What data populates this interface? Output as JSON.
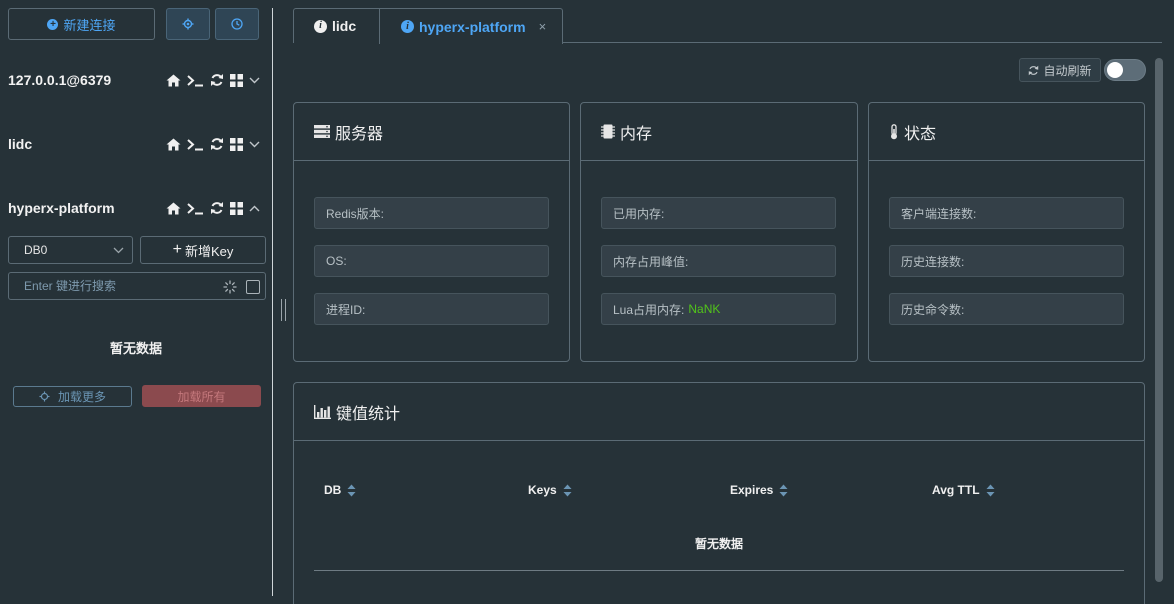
{
  "sidebar": {
    "new_connection_label": "新建连接",
    "settings_icon": "gear-icon",
    "history_icon": "clock-icon",
    "connections": [
      {
        "name": "127.0.0.1@6379",
        "expanded": false
      },
      {
        "name": "lidc",
        "expanded": false
      },
      {
        "name": "hyperx-platform",
        "expanded": true
      }
    ],
    "db_select_value": "DB0",
    "new_key_label": "新增Key",
    "search_placeholder": "Enter 键进行搜索",
    "empty_text": "暂无数据",
    "load_more_label": "加载更多",
    "load_all_label": "加载所有"
  },
  "tabs": [
    {
      "label": "lidc",
      "active": false
    },
    {
      "label": "hyperx-platform",
      "active": true,
      "close": "×"
    }
  ],
  "toolbar": {
    "auto_refresh_label": "自动刷新",
    "auto_refresh_enabled": false
  },
  "cards": {
    "server": {
      "title": "服务器",
      "fields": [
        "Redis版本:",
        "OS:",
        "进程ID:"
      ]
    },
    "memory": {
      "title": "内存",
      "fields": [
        "已用内存:",
        "内存占用峰值:",
        "Lua占用内存:"
      ],
      "lua_value": "NaNK"
    },
    "status": {
      "title": "状态",
      "fields": [
        "客户端连接数:",
        "历史连接数:",
        "历史命令数:"
      ]
    },
    "stats": {
      "title": "键值统计",
      "columns": [
        "DB",
        "Keys",
        "Expires",
        "Avg TTL"
      ],
      "empty_text": "暂无数据"
    }
  },
  "colors": {
    "background": "#263238",
    "accent": "#4ea6f5",
    "value_green": "#52c41a",
    "danger": "#8b4a4e"
  }
}
